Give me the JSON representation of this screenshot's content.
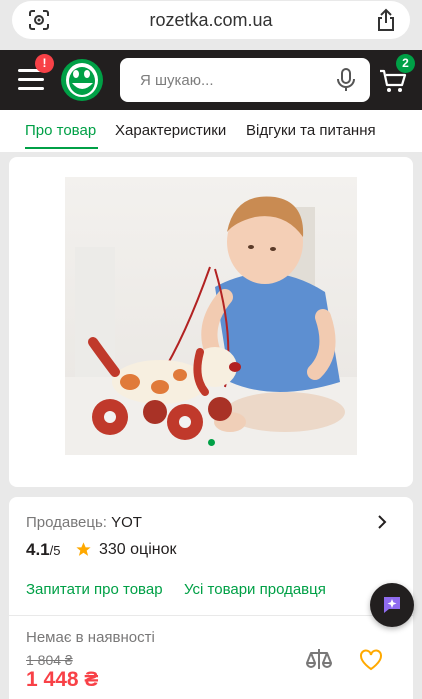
{
  "browser": {
    "url": "rozetka.com.ua",
    "icons": [
      "scan-icon",
      "share-icon"
    ]
  },
  "header": {
    "menu_badge": "!",
    "search_placeholder": "Я шукаю...",
    "cart_count": "2",
    "colors": {
      "header_bg": "#221f1f",
      "brand_green": "#00a046",
      "alert_red": "#f84147"
    }
  },
  "tabs": [
    {
      "label": "Про товар",
      "active": true
    },
    {
      "label": "Характеристики",
      "active": false
    },
    {
      "label": "Відгуки та питання",
      "active": false
    }
  ],
  "gallery": {
    "slide_count": 1,
    "current": 1
  },
  "product": {
    "seller_label": "Продавець:",
    "seller_name": "YOT",
    "rating": "4.1",
    "rating_max": "/5",
    "reviews": "330 оцінок",
    "ask_link": "Запитати про товар",
    "all_products_link": "Усі товари продавця",
    "stock_status": "Немає в наявності",
    "old_price": "1 804 ₴",
    "price": "1 448 ₴"
  }
}
